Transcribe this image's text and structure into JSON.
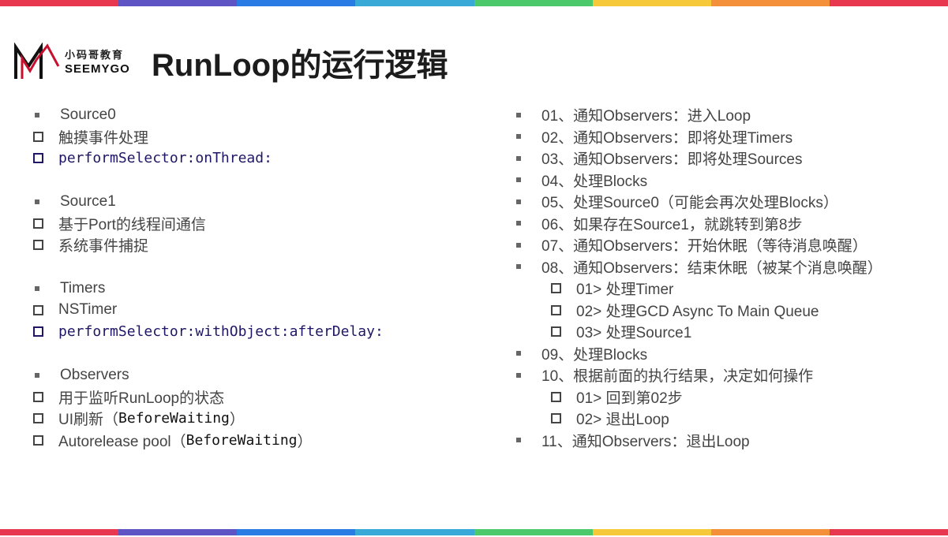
{
  "header": {
    "logo_cn": "小码哥教育",
    "logo_en": "SEEMYGO",
    "title": "RunLoop的运行逻辑"
  },
  "colors": {
    "stripe": [
      "#e8384f",
      "#5e54c4",
      "#2a7be4",
      "#39a9d8",
      "#4cc96a",
      "#f5c93a",
      "#f5903a",
      "#e8384f"
    ],
    "logo_red": "#c8102e",
    "code": "#1f1666"
  },
  "left": {
    "source0": {
      "heading": "Source0",
      "items": [
        "触摸事件处理",
        "performSelector:onThread:"
      ]
    },
    "source1": {
      "heading": "Source1",
      "items": [
        "基于Port的线程间通信",
        "系统事件捕捉"
      ]
    },
    "timers": {
      "heading": "Timers",
      "items": [
        "NSTimer",
        "performSelector:withObject:afterDelay:"
      ]
    },
    "observers": {
      "heading": "Observers",
      "item1": "用于监听RunLoop的状态",
      "item2_prefix": "UI刷新（",
      "item2_code": "BeforeWaiting",
      "item2_suffix": "）",
      "item3_prefix": "Autorelease pool（",
      "item3_code": "BeforeWaiting",
      "item3_suffix": "）"
    }
  },
  "right": {
    "steps": [
      "01、通知Observers：进入Loop",
      "02、通知Observers：即将处理Timers",
      "03、通知Observers：即将处理Sources",
      "04、处理Blocks",
      "05、处理Source0（可能会再次处理Blocks）",
      "06、如果存在Source1，就跳转到第8步",
      "07、通知Observers：开始休眠（等待消息唤醒）",
      "08、通知Observers：结束休眠（被某个消息唤醒）",
      "09、处理Blocks",
      "10、根据前面的执行结果，决定如何操作",
      "11、通知Observers：退出Loop"
    ],
    "step8_sub": [
      "01> 处理Timer",
      "02> 处理GCD Async To Main Queue",
      "03> 处理Source1"
    ],
    "step10_sub": [
      "01> 回到第02步",
      "02> 退出Loop"
    ]
  }
}
